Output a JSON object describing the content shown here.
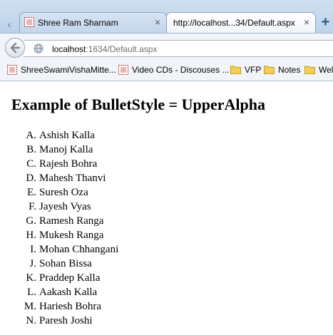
{
  "tabs": [
    {
      "title": "Shree Ram Sharnam",
      "close": "×"
    },
    {
      "title": "http://localhost...34/Default.aspx",
      "close": "×"
    }
  ],
  "new_tab_label": "+",
  "address": {
    "host": "localhost",
    "rest": ":1634/Default.aspx"
  },
  "bookmarks": [
    {
      "label": "ShreeSwamiVishaMitte...",
      "icon": "page-icon"
    },
    {
      "label": "Video CDs - Discouses ...",
      "icon": "page-icon"
    },
    {
      "label": "VFP",
      "icon": "folder-icon"
    },
    {
      "label": "Notes",
      "icon": "folder-icon"
    },
    {
      "label": "Wel",
      "icon": "folder-icon"
    }
  ],
  "page": {
    "heading": "Example of BulletStyle = UpperAlpha",
    "items": [
      {
        "marker": "A.",
        "name": "Ashish Kalla"
      },
      {
        "marker": "B.",
        "name": "Manoj Kalla"
      },
      {
        "marker": "C.",
        "name": "Rajesh Bohra"
      },
      {
        "marker": "D.",
        "name": "Mahesh Thanvi"
      },
      {
        "marker": "E.",
        "name": "Suresh Oza"
      },
      {
        "marker": "F.",
        "name": "Jayesh Vyas"
      },
      {
        "marker": "G.",
        "name": "Ramesh Ranga"
      },
      {
        "marker": "H.",
        "name": "Mukesh Ranga"
      },
      {
        "marker": "I.",
        "name": "Mohan Chhangani"
      },
      {
        "marker": "J.",
        "name": "Sohan Bissa"
      },
      {
        "marker": "K.",
        "name": "Praddep Kalla"
      },
      {
        "marker": "L.",
        "name": "Aakash Kalla"
      },
      {
        "marker": "M.",
        "name": "Hariesh Bohra"
      },
      {
        "marker": "N.",
        "name": "Paresh Joshi"
      }
    ]
  }
}
